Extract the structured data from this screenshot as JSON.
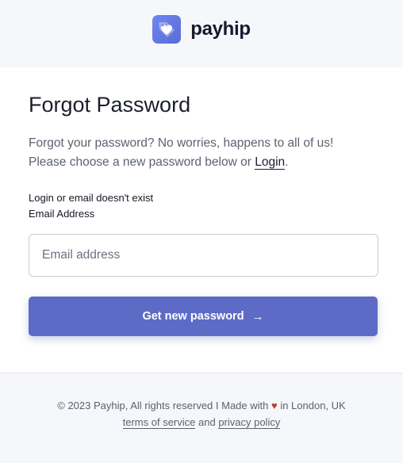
{
  "brand": {
    "name": "payhip"
  },
  "page": {
    "title": "Forgot Password",
    "intro_line1": "Forgot your password? No worries, happens to all of us!",
    "intro_line2_prefix": "Please choose a new password below or ",
    "login_link": "Login",
    "intro_line2_suffix": ".",
    "error_message": "Login or email doesn't exist",
    "email_label": "Email Address",
    "email_placeholder": "Email address",
    "email_value": "",
    "submit_label": "Get new password",
    "submit_arrow": "→"
  },
  "footer": {
    "copyright_prefix": "© 2023 Payhip, All rights reserved I Made with ",
    "heart": "♥",
    "copyright_suffix": " in London, UK",
    "terms_link": "terms of service",
    "and_text": " and ",
    "privacy_link": "privacy policy"
  },
  "colors": {
    "accent": "#5d6bc6",
    "logo": "#6f86f0",
    "heart": "#c0392b"
  }
}
